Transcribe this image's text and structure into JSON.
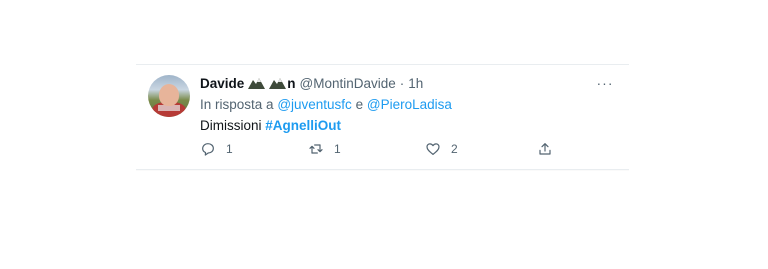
{
  "tweet": {
    "display_name": "Davide",
    "name_emojis": [
      "mountain-icon",
      "mountain-icon"
    ],
    "name_tail": "n",
    "handle": "@MontinDavide",
    "separator": "·",
    "time": "1h",
    "reply_prefix": "In risposta a",
    "reply_mention_1": "@juventusfc",
    "reply_joiner": "e",
    "reply_mention_2": "@PieroLadisa",
    "text_plain": "Dimissioni",
    "text_hashtag": "#AgnelliOut",
    "more_label": "···",
    "actions": {
      "reply_count": "1",
      "retweet_count": "1",
      "like_count": "2"
    }
  },
  "colors": {
    "accent": "#1d9bf0",
    "secondary_text": "#536471",
    "primary_text": "#0f1419"
  }
}
